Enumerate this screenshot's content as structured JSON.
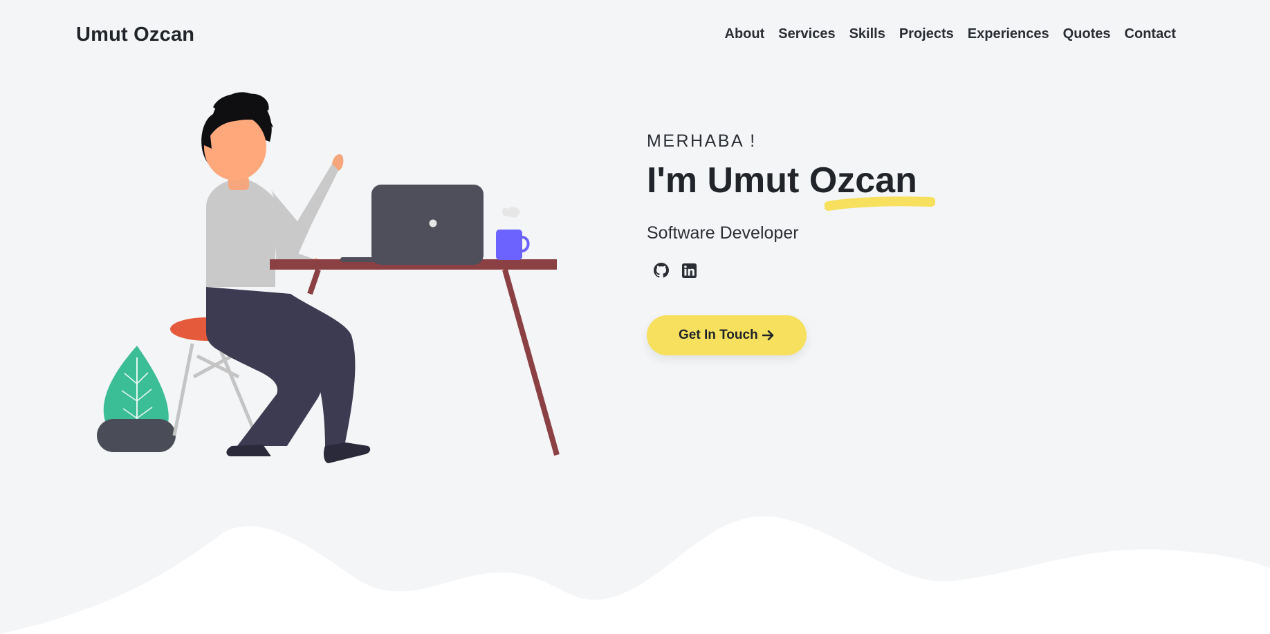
{
  "header": {
    "brand": "Umut Ozcan",
    "nav": [
      {
        "label": "About"
      },
      {
        "label": "Services"
      },
      {
        "label": "Skills"
      },
      {
        "label": "Projects"
      },
      {
        "label": "Experiences"
      },
      {
        "label": "Quotes"
      },
      {
        "label": "Contact"
      }
    ]
  },
  "hero": {
    "greeting": "MERHABA !",
    "title": "I'm Umut Ozcan",
    "role": "Software Developer",
    "socials": [
      {
        "icon": "github-icon"
      },
      {
        "icon": "linkedin-icon"
      }
    ],
    "cta_label": "Get In Touch",
    "cta_icon": "arrow-right-icon"
  },
  "colors": {
    "background": "#f4f5f7",
    "accent": "#f6e05e",
    "text": "#212529",
    "wave": "#ffffff"
  }
}
